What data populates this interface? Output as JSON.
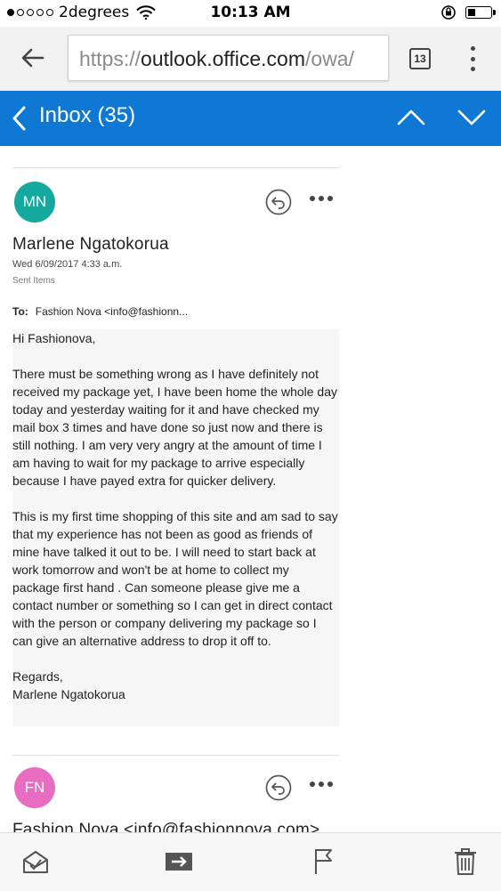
{
  "status_bar": {
    "carrier": "2degrees",
    "time": "10:13 AM"
  },
  "browser": {
    "url_prefix": "https://",
    "url_host": "outlook.office.com",
    "url_path": "/owa/",
    "tab_count": "13"
  },
  "app_bar": {
    "title": "Inbox (35)",
    "accent_color": "#0f78d4"
  },
  "messages": [
    {
      "avatar_initials": "MN",
      "avatar_color": "#14a89e",
      "sender": "Marlene Ngatokorua",
      "date": "Wed 6/09/2017 4:33 a.m.",
      "folder": "Sent Items",
      "to_label": "To:",
      "to_value": "Fashion Nova <info@fashionn...",
      "body": "Hi Fashionova,\n\nThere must be something wrong as I have definitely not received my package yet, I have been home the whole day today and yesterday waiting for it and have checked my mail box 3 times and have done so just now and there is still nothing. I am very very angry at the amount of time I am having to wait for my package to arrive especially because I have payed extra for quicker delivery.\n\nThis is my first time shopping of this site and am sad to say that my experience has not been as good as friends of mine have talked it out to be. I will need to start back at work tomorrow and won't be at home to collect my package first hand . Can someone please give me a contact number or something so I can get in direct contact with the person or company delivering my package so I can give an alternative address to drop it off to.\n\nRegards,\nMarlene Ngatokorua"
    },
    {
      "avatar_initials": "FN",
      "avatar_color": "#e86cc0",
      "sender": "Fashion Nova <info@fashionnova.com>"
    }
  ]
}
